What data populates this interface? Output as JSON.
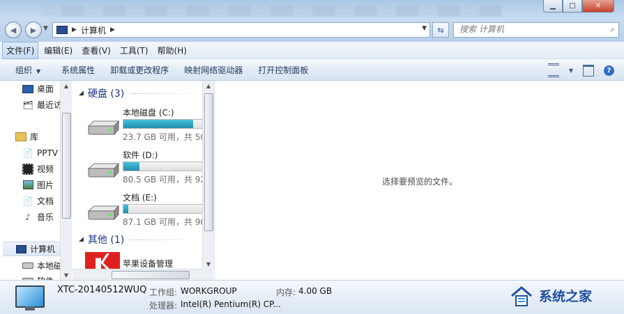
{
  "window": {
    "controls": {
      "minimize": "▁",
      "maximize": "□",
      "close": "✕"
    }
  },
  "address": {
    "crumb": "计算机",
    "search_placeholder": "搜索 计算机"
  },
  "menu": [
    "文件(F)",
    "编辑(E)",
    "查看(V)",
    "工具(T)",
    "帮助(H)"
  ],
  "menu_active_index": 0,
  "toolbar": {
    "organize": "组织",
    "items": [
      "系统属性",
      "卸载或更改程序",
      "映射网络驱动器",
      "打开控制面板"
    ]
  },
  "nav": {
    "items": [
      {
        "label": "桌面",
        "icon": "desktop-icon"
      },
      {
        "label": "最近访",
        "icon": "recent-places-icon"
      },
      {
        "label": "库",
        "icon": "library-icon"
      },
      {
        "label": "PPTV",
        "icon": "folder-icon"
      },
      {
        "label": "视频",
        "icon": "video-library-icon"
      },
      {
        "label": "图片",
        "icon": "pictures-library-icon"
      },
      {
        "label": "文档",
        "icon": "documents-library-icon"
      },
      {
        "label": "音乐",
        "icon": "music-library-icon"
      },
      {
        "label": "计算机",
        "icon": "computer-icon"
      },
      {
        "label": "本地磁",
        "icon": "drive-icon"
      },
      {
        "label": "软件",
        "icon": "drive-icon"
      }
    ]
  },
  "groups": {
    "drives_header": "硬盘 (3)",
    "other_header": "其他 (1)"
  },
  "drives": [
    {
      "name": "本地磁盘 (C:)",
      "free_text": "23.7 GB 可用，共 50",
      "used_fraction": 0.83
    },
    {
      "name": "软件 (D:)",
      "free_text": "80.5 GB 可用，共 92",
      "used_fraction": 0.19
    },
    {
      "name": "文档 (E:)",
      "free_text": "87.1 GB 可用，共 90",
      "used_fraction": 0.06
    }
  ],
  "other_item": "苹果设备管理",
  "preview": {
    "message": "选择要预览的文件。"
  },
  "details": {
    "computer_name": "XTC-20140512WUQ",
    "workgroup_label": "工作组:",
    "workgroup_value": "WORKGROUP",
    "memory_label": "内存:",
    "memory_value": "4.00 GB",
    "processor_label": "处理器:",
    "processor_value": "Intel(R) Pentium(R) CP..."
  },
  "watermark": {
    "text": "系统之家"
  },
  "colors": {
    "accent": "#1e3287",
    "drive_bar": "#1f8fb0",
    "watermark": "#1d4f9c"
  }
}
